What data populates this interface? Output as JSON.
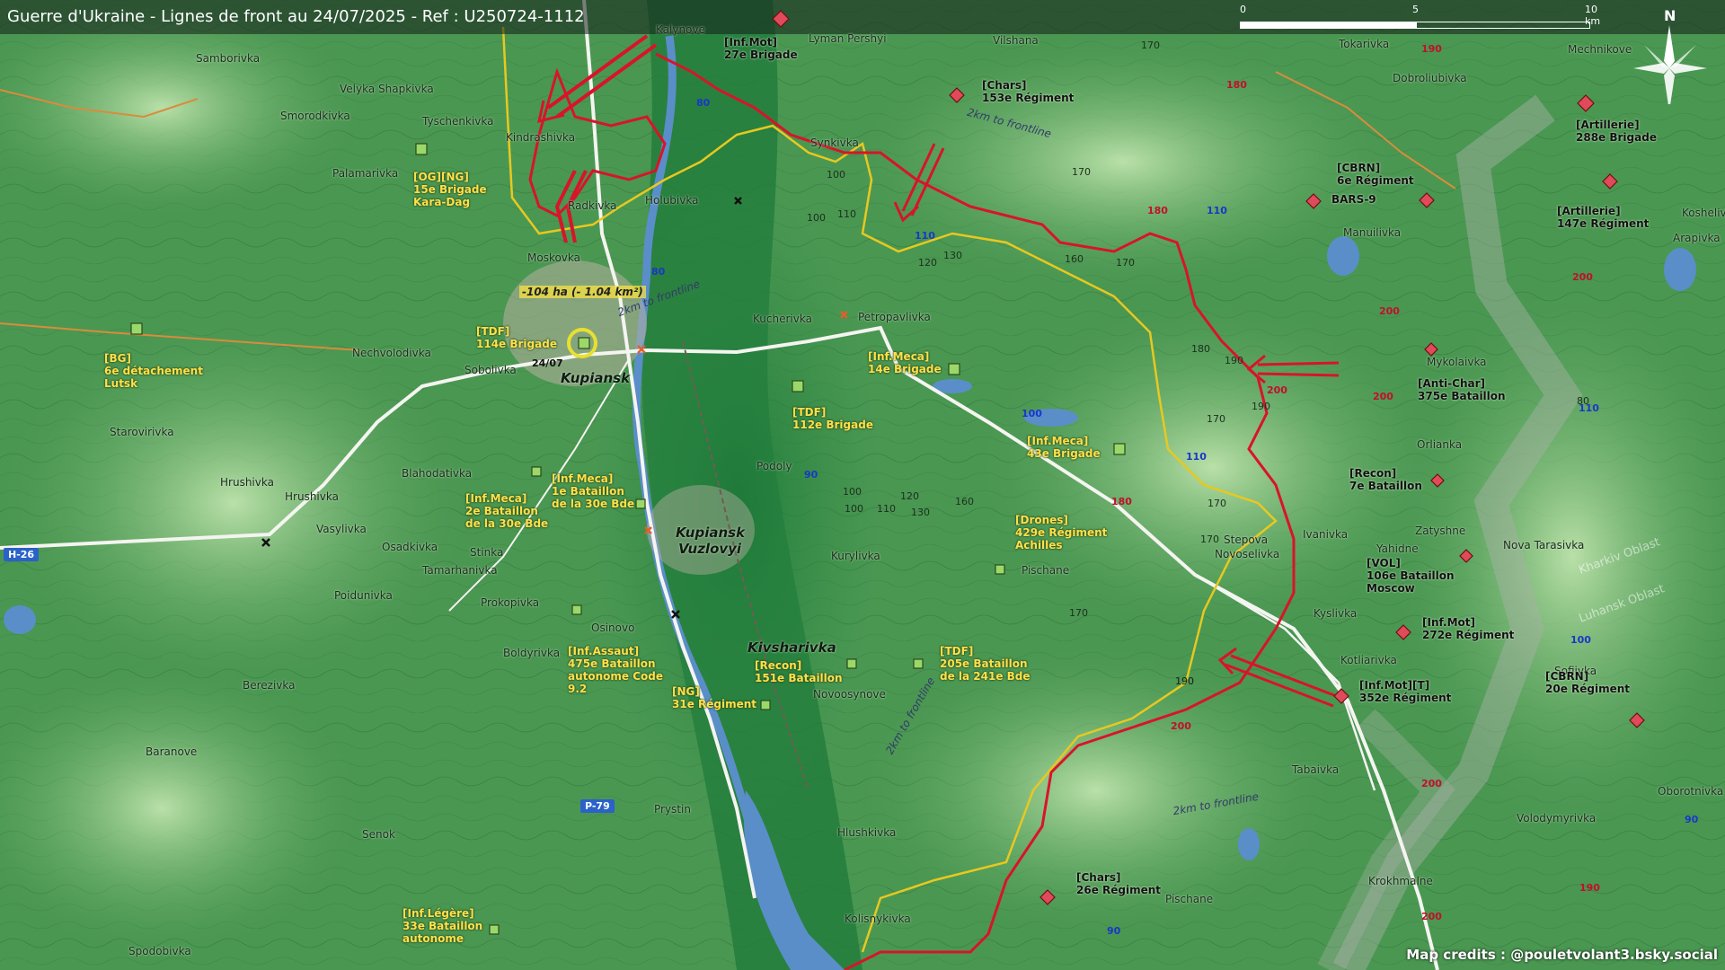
{
  "title": "Guerre d'Ukraine - Lignes de front au 24/07/2025 - Ref : U250724-1112",
  "scale": {
    "labels": [
      "0",
      "5",
      "10 km"
    ]
  },
  "north_label": "N",
  "credits": "Map credits : @pouletvolant3.bsky.social",
  "gain_label": "-104 ha (- 1.04 km²)",
  "date_tag": "24/07",
  "oblast_labels": [
    "Kharkiv Oblast",
    "Luhansk Oblast"
  ],
  "frontline_label": "2km to frontline",
  "road_shields": [
    "H-26",
    "P-79"
  ],
  "places": [
    "Kalynove",
    "Lyman Pershyi",
    "Vilshana",
    "Tokarivka",
    "Mechnikove",
    "Samborivka",
    "Velyka Shapkivka",
    "Dobroliubivka",
    "Smorodkivka",
    "Tyschenkivka",
    "Kindrashivka",
    "Synkivka",
    "Palamarivka",
    "Radkivka",
    "Holubivka",
    "Manuilivka",
    "Koshelivka",
    "Arapivka",
    "Moskovka",
    "Kucherivka",
    "Petropavlivka",
    "Nechvolodivka",
    "Sobolivka",
    "Kupiansk",
    "Mykolaivka",
    "Starovirivka",
    "Orlianka",
    "Hrushivka",
    "Blahodativka",
    "Podoly",
    "Hrushivka",
    "Vasylivka",
    "Kupiansk\nVuzlovyi",
    "Osadkivka",
    "Stinka",
    "Kurylivka",
    "Ivanivka",
    "Stepova\nNovoselivka",
    "Yahidne",
    "Zatyshne",
    "Nova Tarasivka",
    "Tamarhanivka",
    "Pischane",
    "Poidunivka",
    "Prokopivka",
    "Kyslivka",
    "Osinovo",
    "Kivsharivka",
    "Boldyrivka",
    "Kotliarivka",
    "Sofiivka",
    "Novoosynove",
    "Berezivka",
    "Baranove",
    "Tabaivka",
    "Prystin",
    "Oborotnivka",
    "Hlushkivka",
    "Senok",
    "Volodymyrivka",
    "Krokhmalne",
    "Pischane",
    "Kolisnykivka",
    "Spodobivka"
  ],
  "units_ua": [
    "[OG][NG]\n15e Brigade\nKara-Dag",
    "[TDF]\n114e Brigade",
    "[BG]\n6e détachement\nLutsk",
    "[Inf.Meca]\n14e Brigade",
    "[TDF]\n112e Brigade",
    "[Inf.Meca]\n43e Brigade",
    "[Inf.Meca]\n1e Bataillon\nde la 30e Bde",
    "[Inf.Meca]\n2e Bataillon\nde la 30e Bde",
    "[Drones]\n429e Régiment\nAchilles",
    "[Inf.Assaut]\n475e Bataillon\nautonome Code\n9.2",
    "[Recon]\n151e Bataillon",
    "[TDF]\n205e Bataillon\nde la 241e Bde",
    "[NG]\n31e Régiment",
    "[Inf.Légère]\n33e Bataillon\nautonome"
  ],
  "units_ru": [
    "[Inf.Mot]\n27e Brigade",
    "[Chars]\n153e Régiment",
    "[Artillerie]\n288e Brigade",
    "[CBRN]\n6e Régiment",
    "BARS-9",
    "[Artillerie]\n147e Régiment",
    "[Anti-Char]\n375e Bataillon",
    "[Recon]\n7e Bataillon",
    "[VOL]\n106e Bataillon\nMoscow",
    "[Inf.Mot]\n272e Régiment",
    "[Inf.Mot][T]\n352e Régiment",
    "[CBRN]\n20e Régiment",
    "[Chars]\n26e Régiment"
  ],
  "contours": [
    "170",
    "190",
    "180",
    "180",
    "170",
    "110",
    "100",
    "110",
    "100",
    "80",
    "80",
    "110",
    "120",
    "130",
    "160",
    "170",
    "190",
    "200",
    "190",
    "180",
    "200",
    "200",
    "170",
    "190",
    "100",
    "110",
    "100",
    "90",
    "100",
    "110",
    "120",
    "130",
    "160",
    "180",
    "170",
    "170",
    "170",
    "190",
    "200",
    "200",
    "200",
    "90",
    "190",
    "90",
    "200",
    "100",
    "110",
    "80"
  ],
  "colors": {
    "front_line": "#d8142a",
    "friendly_line": "#e8c820",
    "ua_unit": "#ffe04a",
    "ru_marker": "#e04a5a",
    "ua_marker": "#9bd86a",
    "water": "#5a8ec8",
    "road": "#f4f4f0"
  }
}
